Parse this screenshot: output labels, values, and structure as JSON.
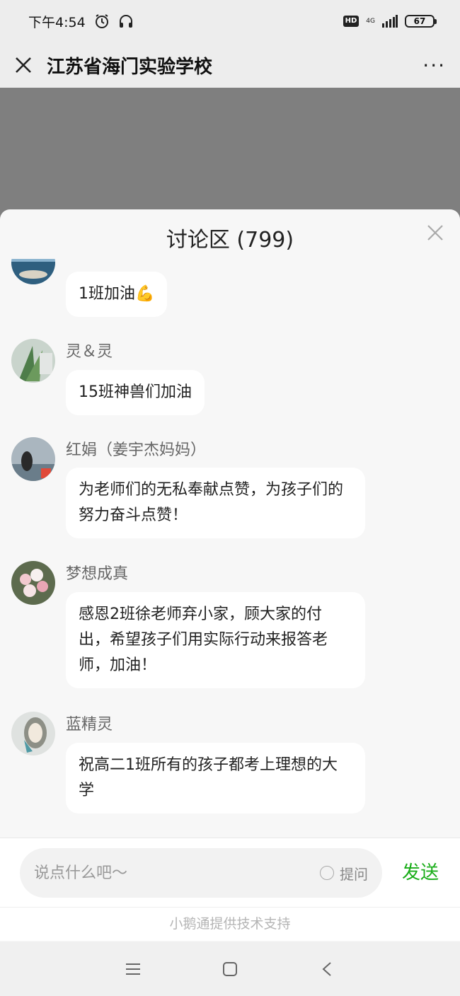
{
  "status": {
    "time": "下午4:54",
    "hd": "HD",
    "network": "4G",
    "battery": "67"
  },
  "header": {
    "title": "江苏省海门实验学校",
    "close_icon": "close-icon",
    "more_label": "···"
  },
  "discussion": {
    "title": "讨论区 (799)",
    "messages": [
      {
        "name": "",
        "text": "1班加油💪"
      },
      {
        "name": "灵＆灵",
        "text": "15班神兽们加油"
      },
      {
        "name": "红娟（姜宇杰妈妈）",
        "text": "为老师们的无私奉献点赞，为孩子们的努力奋斗点赞！"
      },
      {
        "name": "梦想成真",
        "text": "感恩2班徐老师弃小家，顾大家的付出，希望孩子们用实际行动来报答老师，加油！"
      },
      {
        "name": "蓝精灵",
        "text": "祝高二1班所有的孩子都考上理想的大学"
      }
    ]
  },
  "input": {
    "placeholder": "说点什么吧～",
    "ask_label": "提问",
    "send_label": "发送"
  },
  "footer": {
    "powered_by": "小鹅通提供技术支持"
  },
  "colors": {
    "accent_green": "#1aad19",
    "overlay_gray": "#7f7f7f"
  }
}
